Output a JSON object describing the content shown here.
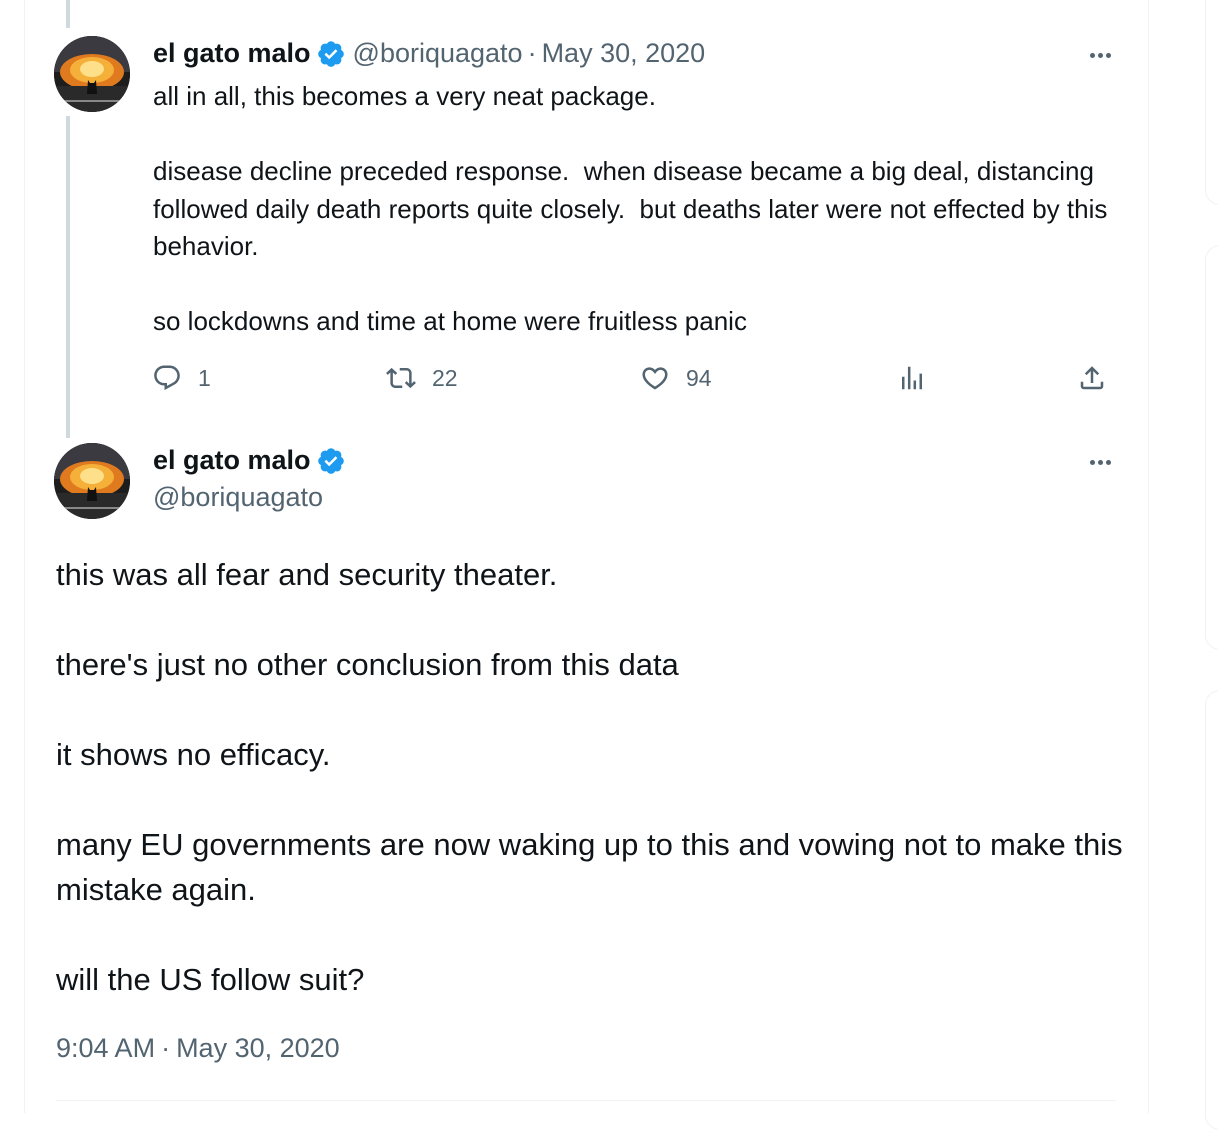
{
  "reply_tweet": {
    "display_name": "el gato malo",
    "handle": "@boriquagato",
    "separator": "·",
    "date": "May 30, 2020",
    "text": "all in all, this becomes a very neat package.\n\ndisease decline preceded response.  when disease became a big deal, distancing followed daily death reports quite closely.  but deaths later were not effected by this behavior.\n\nso lockdowns and time at home were fruitless panic",
    "replies": "1",
    "retweets": "22",
    "likes": "94",
    "icons": {
      "reply": "speech-bubble-icon",
      "retweet": "retweet-arrows-icon",
      "like": "heart-icon",
      "views": "bar-chart-icon",
      "share": "share-upload-icon",
      "verified": "verified-badge-icon",
      "more": "more-dots-icon"
    }
  },
  "main_tweet": {
    "display_name": "el gato malo",
    "handle": "@boriquagato",
    "text": "this was all fear and security theater.\n\nthere's just no other conclusion from this data\n\nit shows no efficacy.\n\nmany EU governments are now waking up to this and vowing not to make this mistake again.\n\nwill the US follow suit?",
    "time": "9:04 AM",
    "separator": "·",
    "date": "May 30, 2020"
  },
  "colors": {
    "text_primary": "#0f1419",
    "text_secondary": "#536471",
    "verified_blue": "#1d9bf0",
    "thread_line": "#cfd9de",
    "border": "#eff3f4"
  }
}
